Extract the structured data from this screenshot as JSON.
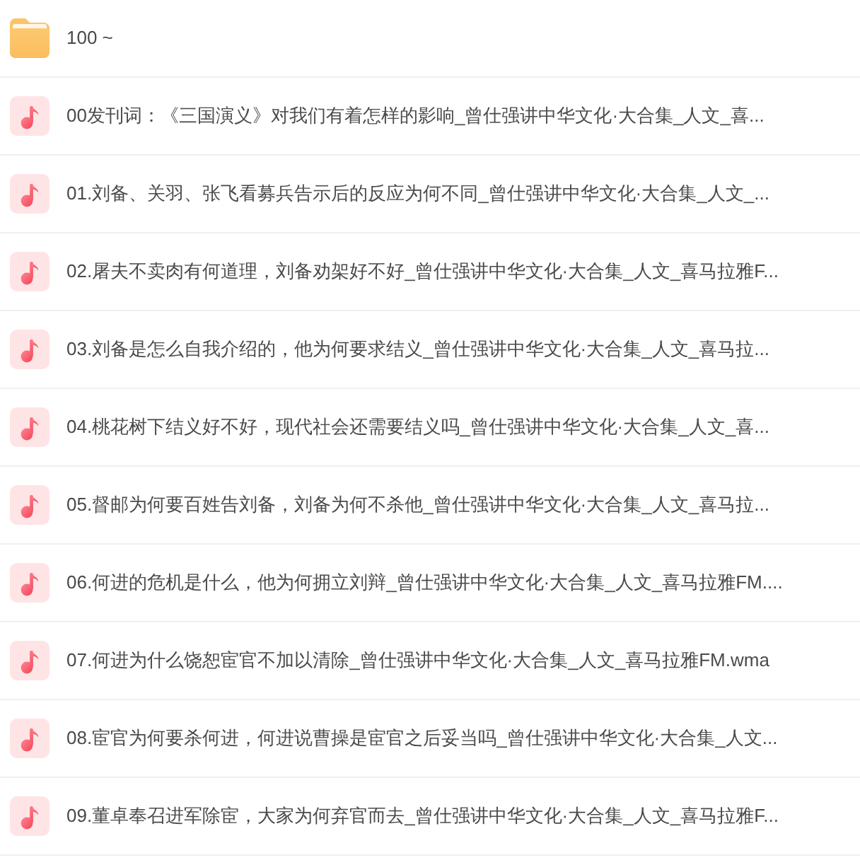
{
  "items": [
    {
      "kind": "folder",
      "name": "100 ~"
    },
    {
      "kind": "audio",
      "name": "00发刊词：《三国演义》对我们有着怎样的影响_曾仕强讲中华文化·大合集_人文_喜..."
    },
    {
      "kind": "audio",
      "name": "01.刘备、关羽、张飞看募兵告示后的反应为何不同_曾仕强讲中华文化·大合集_人文_..."
    },
    {
      "kind": "audio",
      "name": "02.屠夫不卖肉有何道理，刘备劝架好不好_曾仕强讲中华文化·大合集_人文_喜马拉雅F..."
    },
    {
      "kind": "audio",
      "name": "03.刘备是怎么自我介绍的，他为何要求结义_曾仕强讲中华文化·大合集_人文_喜马拉..."
    },
    {
      "kind": "audio",
      "name": "04.桃花树下结义好不好，现代社会还需要结义吗_曾仕强讲中华文化·大合集_人文_喜..."
    },
    {
      "kind": "audio",
      "name": "05.督邮为何要百姓告刘备，刘备为何不杀他_曾仕强讲中华文化·大合集_人文_喜马拉..."
    },
    {
      "kind": "audio",
      "name": "06.何进的危机是什么，他为何拥立刘辩_曾仕强讲中华文化·大合集_人文_喜马拉雅FM...."
    },
    {
      "kind": "audio",
      "name": "07.何进为什么饶恕宦官不加以清除_曾仕强讲中华文化·大合集_人文_喜马拉雅FM.wma"
    },
    {
      "kind": "audio",
      "name": "08.宦官为何要杀何进，何进说曹操是宦官之后妥当吗_曾仕强讲中华文化·大合集_人文..."
    },
    {
      "kind": "audio",
      "name": "09.董卓奉召进军除宦，大家为何弃官而去_曾仕强讲中华文化·大合集_人文_喜马拉雅F..."
    }
  ]
}
